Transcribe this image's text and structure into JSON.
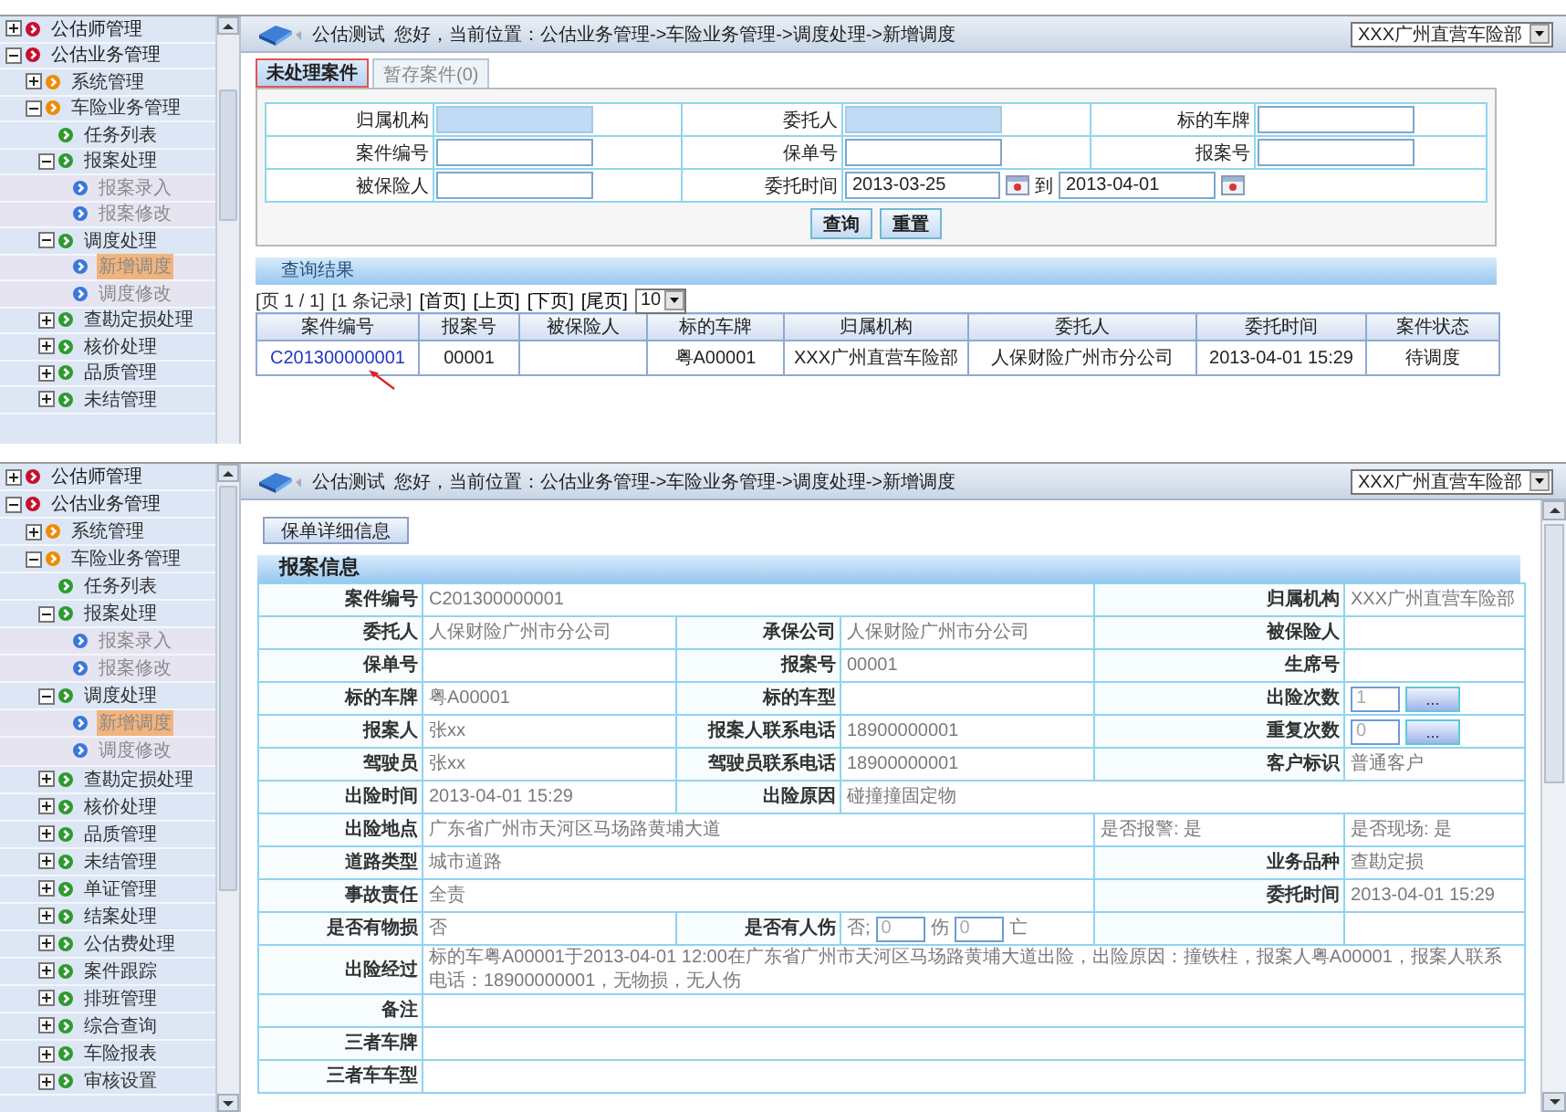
{
  "screens": [
    {
      "kind": "list",
      "sidebar": {
        "items": [
          {
            "kind": "folder",
            "label": "公估师管理",
            "expanded": false
          },
          {
            "kind": "folder",
            "label": "公估业务管理",
            "expanded": true,
            "children": [
              {
                "kind": "folder",
                "label": "系统管理",
                "expanded": false
              },
              {
                "kind": "folder",
                "label": "车险业务管理",
                "expanded": true,
                "children": [
                  {
                    "kind": "page",
                    "label": "任务列表",
                    "selected": false
                  },
                  {
                    "kind": "folder",
                    "label": "报案处理",
                    "expanded": true,
                    "children": [
                      {
                        "kind": "page",
                        "label": "报案录入",
                        "selected": false
                      },
                      {
                        "kind": "page",
                        "label": "报案修改",
                        "selected": false
                      }
                    ]
                  },
                  {
                    "kind": "folder",
                    "label": "调度处理",
                    "expanded": true,
                    "children": [
                      {
                        "kind": "page",
                        "label": "新增调度",
                        "selected": true
                      },
                      {
                        "kind": "page",
                        "label": "调度修改",
                        "selected": false
                      }
                    ]
                  },
                  {
                    "kind": "folder",
                    "label": "查勘定损处理",
                    "expanded": false
                  },
                  {
                    "kind": "folder",
                    "label": "核价处理",
                    "expanded": false
                  },
                  {
                    "kind": "folder",
                    "label": "品质管理",
                    "expanded": false
                  },
                  {
                    "kind": "folder",
                    "label": "未结管理",
                    "expanded": false
                  }
                ]
              }
            ]
          }
        ]
      },
      "header": {
        "user": "公估测试",
        "location": "您好，当前位置：公估业务管理->车险业务管理->调度处理->新增调度",
        "branch": "XXX广州直营车险部"
      },
      "tabs": [
        {
          "label": "未处理案件",
          "selected": true
        },
        {
          "label": "暂存案件(0)",
          "selected": false
        }
      ],
      "search_form": {
        "fields": [
          {
            "kind": "text",
            "label": "归属机构",
            "disabled": true
          },
          {
            "kind": "text",
            "label": "委托人",
            "disabled": true
          },
          {
            "kind": "text",
            "label": "标的车牌",
            "disabled": false
          },
          {
            "kind": "text",
            "label": "案件编号",
            "disabled": false
          },
          {
            "kind": "text",
            "label": "保单号",
            "disabled": false
          },
          {
            "kind": "text",
            "label": "报案号",
            "disabled": false
          },
          {
            "kind": "text",
            "label": "被保险人",
            "disabled": false
          },
          {
            "kind": "date_range",
            "label": "委托时间",
            "from": "2013-03-25",
            "separator": "到",
            "to": "2013-04-01"
          }
        ],
        "buttons": [
          "查询",
          "重置"
        ]
      },
      "results": {
        "title": "查询结果",
        "pager": [
          {
            "kind": "info",
            "text": "[页 1 / 1]"
          },
          {
            "kind": "info",
            "text": "[1 条记录]"
          },
          {
            "kind": "link",
            "text": "[首页]"
          },
          {
            "kind": "link",
            "text": "[上页]"
          },
          {
            "kind": "link",
            "text": "[下页]"
          },
          {
            "kind": "link",
            "text": "[尾页]"
          }
        ],
        "page_size": "10",
        "columns": [
          {
            "label": "案件编号",
            "kind": "link"
          },
          {
            "label": "报案号",
            "kind": "text"
          },
          {
            "label": "被保险人",
            "kind": "text"
          },
          {
            "label": "标的车牌",
            "kind": "text"
          },
          {
            "label": "归属机构",
            "kind": "text"
          },
          {
            "label": "委托人",
            "kind": "text"
          },
          {
            "label": "委托时间",
            "kind": "text"
          },
          {
            "label": "案件状态",
            "kind": "text"
          }
        ],
        "rows": [
          {
            "cells": [
              "C201300000001",
              "00001",
              null,
              "粤A00001",
              "XXX广州直营车险部",
              "人保财险广州市分公司",
              "2013-04-01 15:29",
              "待调度"
            ]
          }
        ]
      }
    },
    {
      "kind": "detail",
      "sidebar": {
        "items": [
          {
            "kind": "folder",
            "label": "公估师管理",
            "expanded": false
          },
          {
            "kind": "folder",
            "label": "公估业务管理",
            "expanded": true,
            "children": [
              {
                "kind": "folder",
                "label": "系统管理",
                "expanded": false
              },
              {
                "kind": "folder",
                "label": "车险业务管理",
                "expanded": true,
                "children": [
                  {
                    "kind": "page",
                    "label": "任务列表",
                    "selected": false
                  },
                  {
                    "kind": "folder",
                    "label": "报案处理",
                    "expanded": true,
                    "children": [
                      {
                        "kind": "page",
                        "label": "报案录入",
                        "selected": false
                      },
                      {
                        "kind": "page",
                        "label": "报案修改",
                        "selected": false
                      }
                    ]
                  },
                  {
                    "kind": "folder",
                    "label": "调度处理",
                    "expanded": true,
                    "children": [
                      {
                        "kind": "page",
                        "label": "新增调度",
                        "selected": true
                      },
                      {
                        "kind": "page",
                        "label": "调度修改",
                        "selected": false
                      }
                    ]
                  },
                  {
                    "kind": "folder",
                    "label": "查勘定损处理",
                    "expanded": false
                  },
                  {
                    "kind": "folder",
                    "label": "核价处理",
                    "expanded": false
                  },
                  {
                    "kind": "folder",
                    "label": "品质管理",
                    "expanded": false
                  },
                  {
                    "kind": "folder",
                    "label": "未结管理",
                    "expanded": false
                  },
                  {
                    "kind": "folder",
                    "label": "单证管理",
                    "expanded": false
                  },
                  {
                    "kind": "folder",
                    "label": "结案处理",
                    "expanded": false
                  },
                  {
                    "kind": "folder",
                    "label": "公估费处理",
                    "expanded": false
                  },
                  {
                    "kind": "folder",
                    "label": "案件跟踪",
                    "expanded": false
                  },
                  {
                    "kind": "folder",
                    "label": "排班管理",
                    "expanded": false
                  },
                  {
                    "kind": "folder",
                    "label": "综合查询",
                    "expanded": false
                  },
                  {
                    "kind": "folder",
                    "label": "车险报表",
                    "expanded": false
                  },
                  {
                    "kind": "folder",
                    "label": "审核设置",
                    "expanded": false
                  }
                ]
              }
            ]
          }
        ]
      },
      "header": {
        "user": "公估测试",
        "location": "您好，当前位置：公估业务管理->车险业务管理->调度处理->新增调度",
        "branch": "XXX广州直营车险部"
      },
      "actions": [
        "保单详细信息"
      ],
      "section_title": "报案信息",
      "rows": [
        {
          "fields": [
            {
              "kind": "wide",
              "label": "案件编号",
              "value": "C201300000001"
            },
            {
              "kind": "pair",
              "label": "归属机构",
              "value": "XXX广州直营车险部"
            }
          ]
        },
        {
          "fields": [
            {
              "kind": "pair",
              "label": "委托人",
              "value": "人保财险广州市分公司"
            },
            {
              "kind": "pair",
              "label": "承保公司",
              "value": "人保财险广州市分公司"
            },
            {
              "kind": "pair",
              "label": "被保险人"
            }
          ]
        },
        {
          "fields": [
            {
              "kind": "pair",
              "label": "保单号"
            },
            {
              "kind": "pair",
              "label": "报案号",
              "value": "00001"
            },
            {
              "kind": "pair",
              "label": "生席号"
            }
          ]
        },
        {
          "fields": [
            {
              "kind": "pair",
              "label": "标的车牌",
              "value": "粤A00001"
            },
            {
              "kind": "pair",
              "label": "标的车型"
            },
            {
              "kind": "counter",
              "label": "出险次数",
              "value": "1",
              "button": "..."
            }
          ]
        },
        {
          "fields": [
            {
              "kind": "pair",
              "label": "报案人",
              "value": "张xx"
            },
            {
              "kind": "pair",
              "label": "报案人联系电话",
              "value": "18900000001"
            },
            {
              "kind": "counter",
              "label": "重复次数",
              "value": "0",
              "button": "..."
            }
          ]
        },
        {
          "fields": [
            {
              "kind": "pair",
              "label": "驾驶员",
              "value": "张xx"
            },
            {
              "kind": "pair",
              "label": "驾驶员联系电话",
              "value": "18900000001"
            },
            {
              "kind": "pair",
              "label": "客户标识",
              "value": "普通客户"
            }
          ]
        },
        {
          "fields": [
            {
              "kind": "pair",
              "label": "出险时间",
              "value": "2013-04-01 15:29"
            },
            {
              "kind": "wide",
              "label": "出险原因",
              "value": "碰撞撞固定物"
            }
          ]
        },
        {
          "fields": [
            {
              "kind": "wide",
              "label": "出险地点",
              "value": "广东省广州市天河区马场路黄埔大道"
            },
            {
              "kind": "note",
              "value": "是否报警: 是"
            },
            {
              "kind": "note",
              "value": "是否现场: 是"
            }
          ]
        },
        {
          "fields": [
            {
              "kind": "wide",
              "label": "道路类型",
              "value": "城市道路"
            },
            {
              "kind": "pair",
              "label": "业务品种",
              "value": "查勘定损"
            }
          ]
        },
        {
          "fields": [
            {
              "kind": "wide",
              "label": "事故责任",
              "value": "全责"
            },
            {
              "kind": "pair",
              "label": "委托时间",
              "value": "2013-04-01 15:29"
            }
          ]
        },
        {
          "fields": [
            {
              "kind": "pair",
              "label": "是否有物损",
              "value": "否"
            },
            {
              "kind": "injury",
              "label": "是否有人伤",
              "value": "否;",
              "inputs": [
                {
                  "value": "0",
                  "suffix": "伤"
                },
                {
                  "value": "0",
                  "suffix": "亡"
                }
              ]
            },
            {
              "kind": "blank"
            }
          ]
        },
        {
          "fields": [
            {
              "kind": "full",
              "label": "出险经过",
              "value": "标的车粤A00001于2013-04-01 12:00在广东省广州市天河区马场路黄埔大道出险，出险原因：撞铁柱，报案人粤A00001，报案人联系电话：18900000001，无物损，无人伤"
            }
          ]
        },
        {
          "fields": [
            {
              "kind": "full",
              "label": "备注"
            }
          ]
        },
        {
          "fields": [
            {
              "kind": "full",
              "label": "三者车牌"
            }
          ]
        },
        {
          "fields": [
            {
              "kind": "full",
              "label": "三者车车型"
            }
          ]
        }
      ]
    }
  ]
}
